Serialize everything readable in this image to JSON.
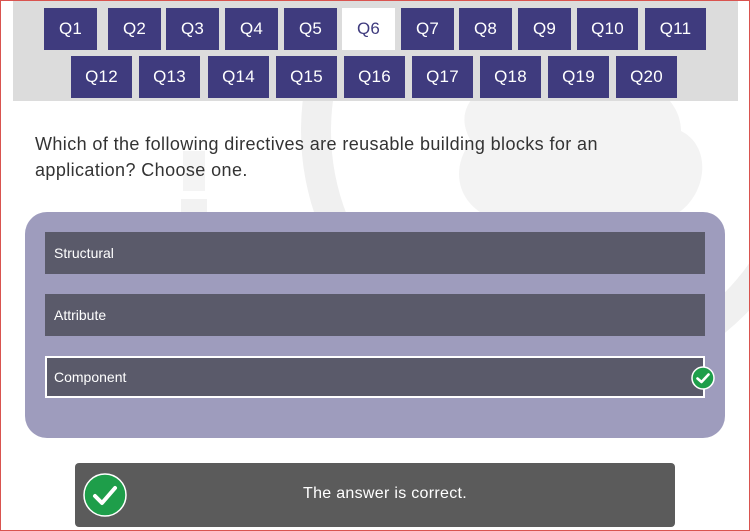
{
  "colors": {
    "nav_button": "#3f3b7e",
    "nav_active": "#ffffff",
    "option_bg": "#5a5a6a",
    "panel_bg": "#9e9cbd",
    "correct_green": "#1e9e4a",
    "feedback_bg": "#5b5b5b"
  },
  "nav": {
    "questions": [
      "Q1",
      "Q2",
      "Q3",
      "Q4",
      "Q5",
      "Q6",
      "Q7",
      "Q8",
      "Q9",
      "Q10",
      "Q11",
      "Q12",
      "Q13",
      "Q14",
      "Q15",
      "Q16",
      "Q17",
      "Q18",
      "Q19",
      "Q20"
    ],
    "active": "Q6"
  },
  "question": {
    "text": "Which of the following directives are reusable building blocks for an application? Choose one."
  },
  "options": [
    {
      "label": "Structural"
    },
    {
      "label": "Attribute"
    },
    {
      "label": "Component"
    }
  ],
  "selected_option": "Component",
  "icons": {
    "option_check": "check-circle-icon",
    "feedback_check": "check-circle-icon"
  },
  "feedback": {
    "text": "The answer is correct."
  }
}
